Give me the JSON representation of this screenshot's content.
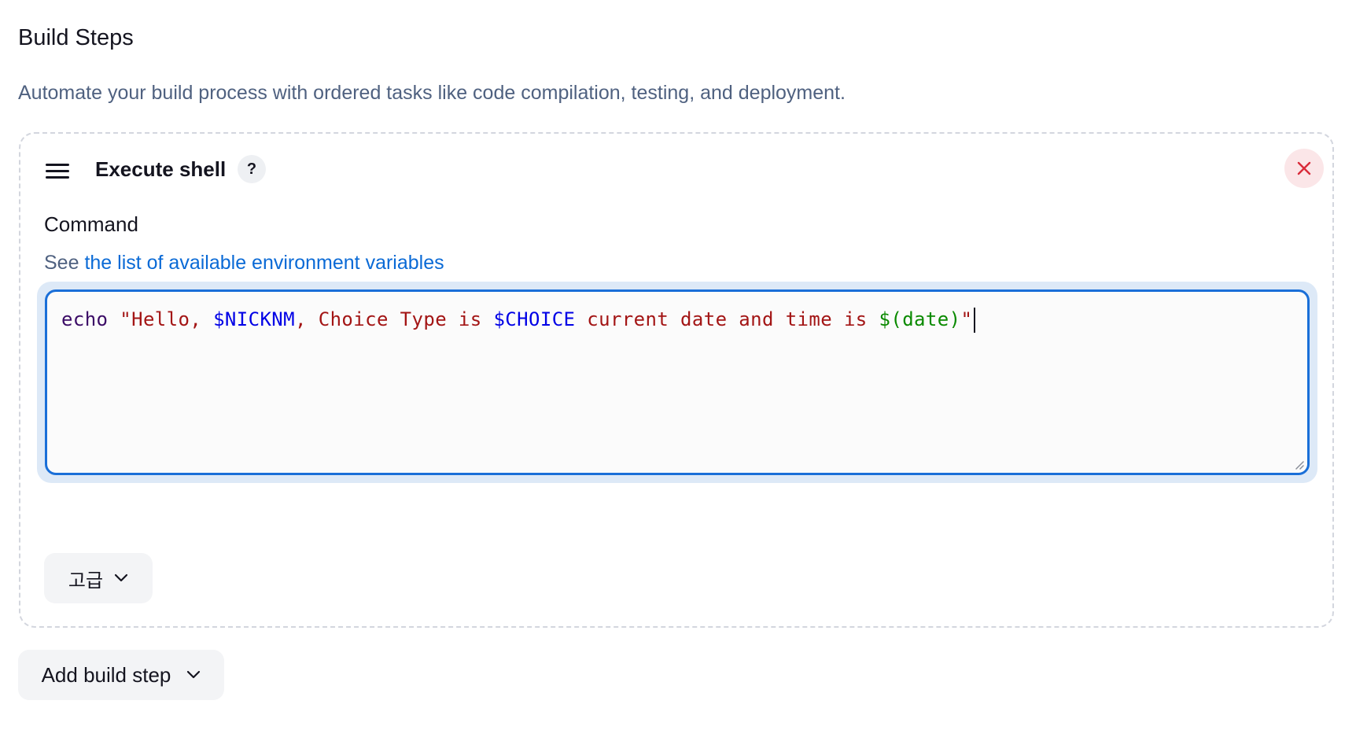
{
  "section": {
    "title": "Build Steps",
    "description": "Automate your build process with ordered tasks like code compilation, testing, and deployment."
  },
  "step": {
    "title": "Execute shell",
    "help_label": "?",
    "command_label": "Command",
    "env_hint_prefix": "See ",
    "env_hint_link": "the list of available environment variables",
    "command_tokens": {
      "t1": "echo",
      "t2": " \"Hello, ",
      "t3": "$NICKNM",
      "t4": ", Choice Type is ",
      "t5": "$CHOICE",
      "t6": " current date and time is ",
      "t7": "$(date)",
      "t8": "\""
    },
    "advanced_label": "고급"
  },
  "footer": {
    "add_step_label": "Add build step"
  },
  "icons": {
    "drag": "drag-handle-icon",
    "remove": "close-icon",
    "dropdown": "chevron-down-icon"
  },
  "colors": {
    "accent": "#1a6fd8",
    "link": "#0a6ad6",
    "remove": "#d92b3a",
    "remove_bg": "#fbe6e8"
  }
}
